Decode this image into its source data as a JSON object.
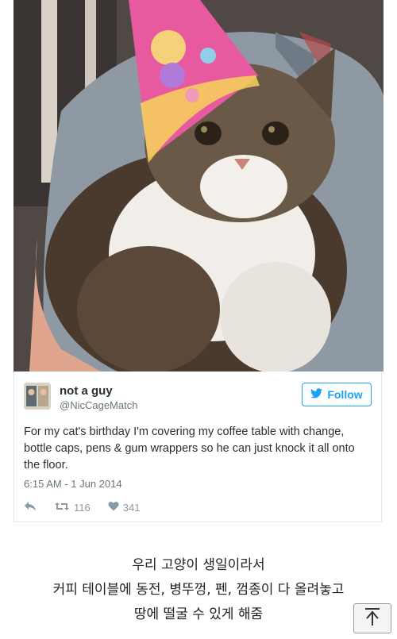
{
  "tweet": {
    "name": "not a guy",
    "handle": "@NicCageMatch",
    "follow_label": "Follow",
    "text": "For my cat's birthday I'm covering my coffee table with change, bottle caps, pens & gum wrappers so he can just knock it all onto the floor.",
    "timestamp": "6:15 AM - 1 Jun 2014",
    "retweets": "116",
    "likes": "341"
  },
  "caption": {
    "line1": "우리 고양이 생일이라서",
    "line2": "커피 테이블에 동전, 병뚜껑, 펜, 껌종이 다 올려놓고",
    "line3": "땅에 떨굴 수 있게 해줌"
  },
  "icons": {
    "reply": "reply-icon",
    "retweet": "retweet-icon",
    "like": "heart-icon",
    "bird": "twitter-bird-icon",
    "scroll_top": "scroll-to-top-icon"
  },
  "colors": {
    "twitter_blue": "#1da1f2",
    "muted": "#8899a6"
  }
}
